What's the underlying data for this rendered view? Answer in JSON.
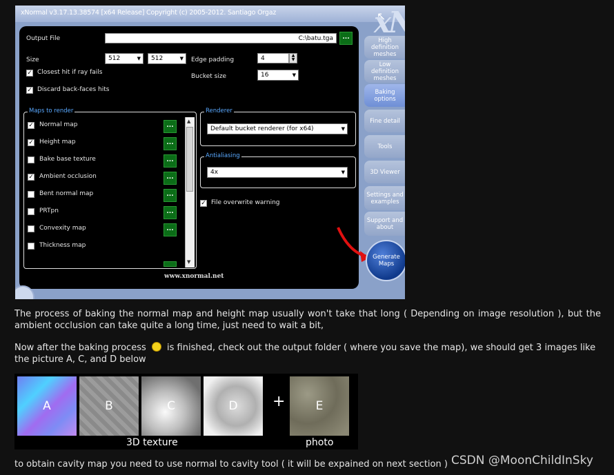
{
  "window": {
    "title": "xNormal v3.17.13.38574 [x64 Release] Copyright (c) 2005-2012. Santiago Orgaz",
    "logo": "xN",
    "footer_url": "www.xnormal.net"
  },
  "output_file": {
    "label": "Output File",
    "value": "C:\\batu.tga",
    "browse": "..."
  },
  "size": {
    "label": "Size",
    "width": "512",
    "height": "512"
  },
  "edge_padding": {
    "label": "Edge padding",
    "value": "4"
  },
  "bucket_size": {
    "label": "Bucket size",
    "value": "16"
  },
  "options": {
    "closest_hit": {
      "label": "Closest hit if ray fails",
      "checked": true
    },
    "discard_backfaces": {
      "label": "Discard back-faces hits",
      "checked": true
    }
  },
  "maps_to_render": {
    "title": "Maps to render",
    "items": [
      {
        "label": "Normal map",
        "checked": true
      },
      {
        "label": "Height map",
        "checked": true
      },
      {
        "label": "Bake base texture",
        "checked": false
      },
      {
        "label": "Ambient occlusion",
        "checked": true
      },
      {
        "label": "Bent normal map",
        "checked": false
      },
      {
        "label": "PRTpn",
        "checked": false
      },
      {
        "label": "Convexity map",
        "checked": false
      },
      {
        "label": "Thickness map",
        "checked": false
      }
    ],
    "item_button": "..."
  },
  "renderer": {
    "title": "Renderer",
    "value": "Default bucket renderer (for x64)"
  },
  "antialiasing": {
    "title": "Antialiasing",
    "value": "4x"
  },
  "file_overwrite": {
    "label": "File overwrite warning",
    "checked": true
  },
  "tabs": [
    {
      "label": "High definition meshes",
      "active": false
    },
    {
      "label": "Low definition meshes",
      "active": false
    },
    {
      "label": "Baking options",
      "active": true
    },
    {
      "label": "Fine detail",
      "active": false
    },
    {
      "label": "Tools",
      "active": false
    },
    {
      "label": "3D Viewer",
      "active": false
    },
    {
      "label": "Settings and examples",
      "active": false
    },
    {
      "label": "Support and about",
      "active": false
    }
  ],
  "generate_button": "Generate Maps",
  "article": {
    "para1": "The process of baking the normal map and height map usually won't take that long ( Depending on image resolution ), but the ambient occlusion can take quite a long time, just need to wait a bit,",
    "para2_before": "Now after the baking process",
    "para2_after": "is finished, check out the output folder ( where you save the map), we should get 3 images like the picture A, C, and D  below",
    "para3": "to obtain cavity map you need to use normal to cavity tool ( it will be expained on next section  )"
  },
  "strip": {
    "tiles": [
      "A",
      "B",
      "C",
      "D",
      "E"
    ],
    "plus": "+",
    "caption_left": "3D texture",
    "caption_right": "photo"
  },
  "watermark": "CSDN @MoonChildInSky",
  "colors": {
    "accent_blue": "#5aa9ff",
    "button_green": "#0b6d17",
    "window_blue": "#8aa1c9"
  }
}
